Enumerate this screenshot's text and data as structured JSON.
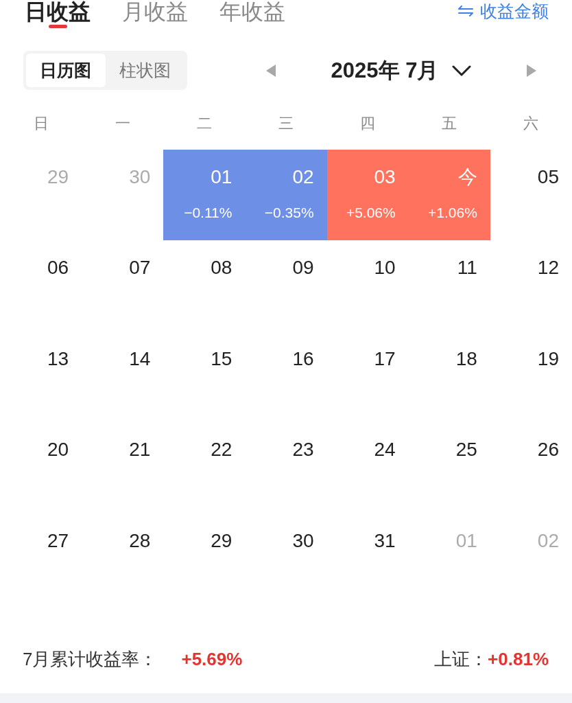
{
  "tabs": [
    {
      "label": "日收益",
      "selected": true
    },
    {
      "label": "月收益",
      "selected": false
    },
    {
      "label": "年收益",
      "selected": false
    }
  ],
  "switch_link": {
    "label": "收益金额"
  },
  "view_modes": [
    {
      "label": "日历图",
      "selected": true
    },
    {
      "label": "柱状图",
      "selected": false
    }
  ],
  "month_picker": {
    "title": "2025年 7月"
  },
  "calendar": {
    "weekdays": [
      "日",
      "一",
      "二",
      "三",
      "四",
      "五",
      "六"
    ],
    "weeks": [
      {
        "days": [
          {
            "day": "29",
            "outside_month": true
          },
          {
            "day": "30",
            "outside_month": true
          },
          {
            "day": "01",
            "outside_month": false,
            "color": "#6e8fe6",
            "change": "−0.11%"
          },
          {
            "day": "02",
            "outside_month": false,
            "color": "#6e8fe6",
            "change": "−0.35%"
          },
          {
            "day": "03",
            "outside_month": false,
            "color": "#ff735e",
            "change": "+5.06%"
          },
          {
            "day": "今",
            "outside_month": false,
            "color": "#ff735e",
            "change": "+1.06%"
          },
          {
            "day": "05",
            "outside_month": false
          }
        ]
      },
      {
        "days": [
          {
            "day": "06",
            "outside_month": false
          },
          {
            "day": "07",
            "outside_month": false
          },
          {
            "day": "08",
            "outside_month": false
          },
          {
            "day": "09",
            "outside_month": false
          },
          {
            "day": "10",
            "outside_month": false
          },
          {
            "day": "11",
            "outside_month": false
          },
          {
            "day": "12",
            "outside_month": false
          }
        ]
      },
      {
        "days": [
          {
            "day": "13",
            "outside_month": false
          },
          {
            "day": "14",
            "outside_month": false
          },
          {
            "day": "15",
            "outside_month": false
          },
          {
            "day": "16",
            "outside_month": false
          },
          {
            "day": "17",
            "outside_month": false
          },
          {
            "day": "18",
            "outside_month": false
          },
          {
            "day": "19",
            "outside_month": false
          }
        ]
      },
      {
        "days": [
          {
            "day": "20",
            "outside_month": false
          },
          {
            "day": "21",
            "outside_month": false
          },
          {
            "day": "22",
            "outside_month": false
          },
          {
            "day": "23",
            "outside_month": false
          },
          {
            "day": "24",
            "outside_month": false
          },
          {
            "day": "25",
            "outside_month": false
          },
          {
            "day": "26",
            "outside_month": false
          }
        ]
      },
      {
        "days": [
          {
            "day": "27",
            "outside_month": false
          },
          {
            "day": "28",
            "outside_month": false
          },
          {
            "day": "29",
            "outside_month": false
          },
          {
            "day": "30",
            "outside_month": false
          },
          {
            "day": "31",
            "outside_month": false
          },
          {
            "day": "01",
            "outside_month": true
          },
          {
            "day": "02",
            "outside_month": true
          }
        ]
      }
    ]
  },
  "summary": {
    "label": "7月累计收益率：",
    "value": "+5.69%"
  },
  "index": {
    "label": "上证：",
    "value": "+0.81%"
  }
}
